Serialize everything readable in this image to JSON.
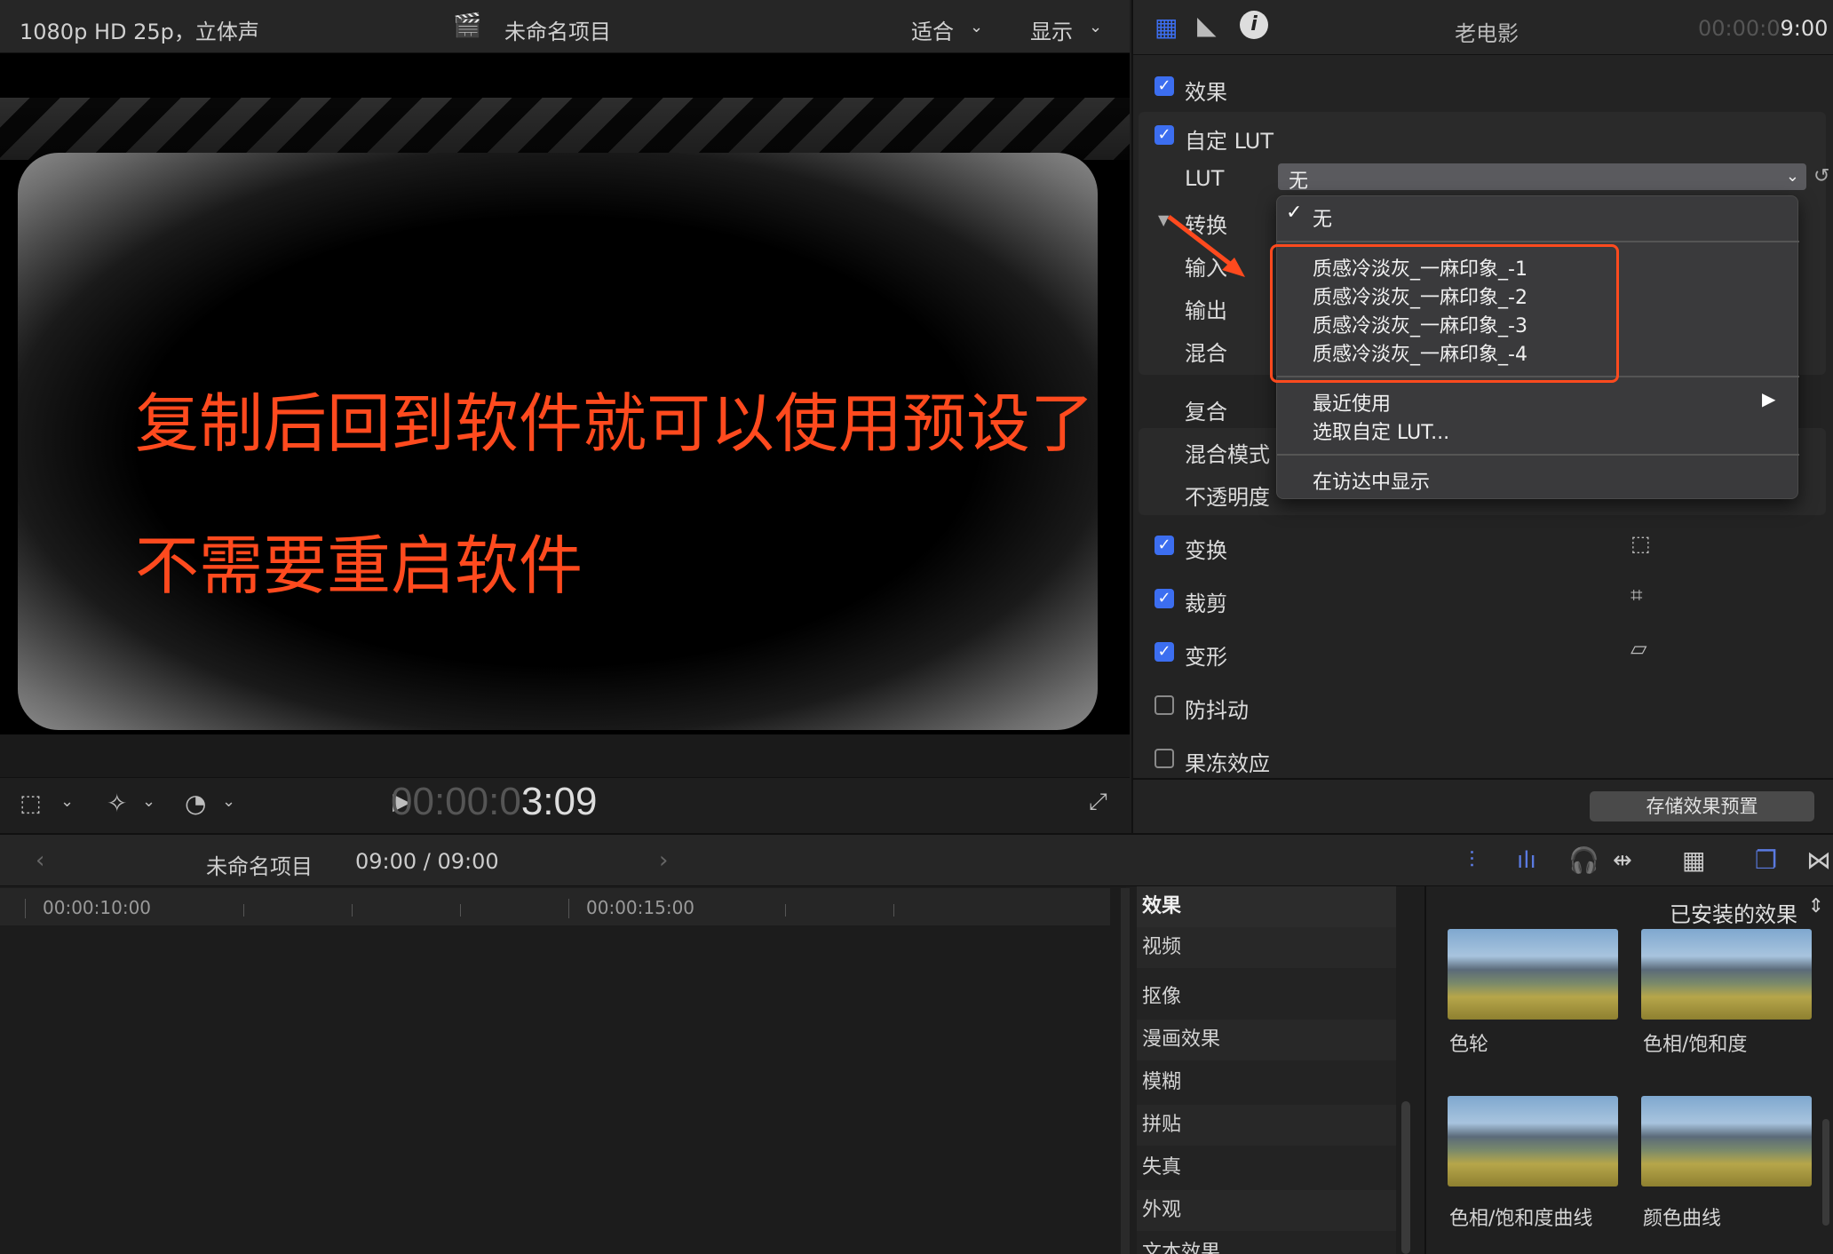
{
  "viewer": {
    "format": "1080p HD 25p，立体声",
    "project_title": "未命名项目",
    "fit_menu": "适合",
    "display_menu": "显示",
    "timecode_dim": "00:00:0",
    "timecode_bright": "3:09",
    "overlay_line1": "复制后回到软件就可以使用预设了",
    "overlay_line2": "不需要重启软件"
  },
  "inspector": {
    "clip_name": "老电影",
    "timecode_dim": "00:00:0",
    "timecode_bright": "9:00",
    "effects_label": "效果",
    "custom_lut_label": "自定 LUT",
    "lut_label": "LUT",
    "lut_value": "无",
    "convert_label": "转换",
    "input_label": "输入",
    "output_label": "输出",
    "mix_label": "混合",
    "composite_label": "复合",
    "blend_mode_label": "混合模式",
    "opacity_label": "不透明度",
    "transform_label": "变换",
    "crop_label": "裁剪",
    "distort_label": "变形",
    "stabilize_label": "防抖动",
    "rolling_shutter_label": "果冻效应",
    "save_preset": "存储效果预置"
  },
  "lut_menu": {
    "selected": "无",
    "items": [
      "质感冷淡灰_一麻印象_-1",
      "质感冷淡灰_一麻印象_-2",
      "质感冷淡灰_一麻印象_-3",
      "质感冷淡灰_一麻印象_-4"
    ],
    "recent": "最近使用",
    "choose_custom": "选取自定 LUT...",
    "show_in_finder": "在访达中显示"
  },
  "timeline": {
    "project_name": "未命名项目",
    "duration": "09:00 / 09:00",
    "ruler_1": "00:00:10:00",
    "ruler_2": "00:00:15:00"
  },
  "effects_browser": {
    "header": "效果",
    "installed": "已安装的效果",
    "categories": [
      "视频",
      "抠像",
      "漫画效果",
      "模糊",
      "拼贴",
      "失真",
      "外观",
      "文本效果"
    ],
    "thumbnails": [
      "色轮",
      "色相/饱和度",
      "色相/饱和度曲线",
      "颜色曲线"
    ]
  },
  "colors": {
    "accent": "#3c6ef0",
    "annotation": "#ff4a1e"
  }
}
